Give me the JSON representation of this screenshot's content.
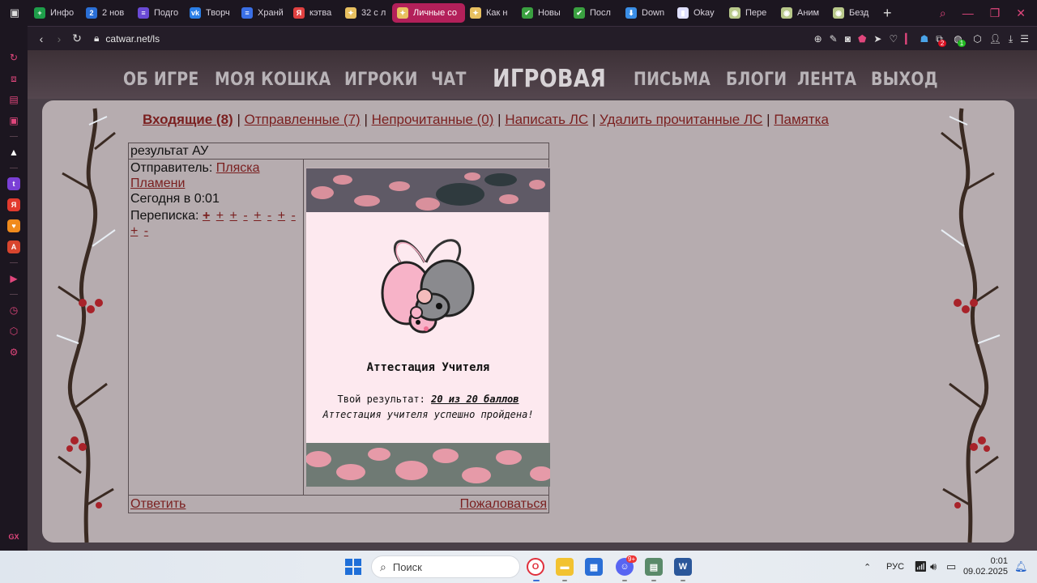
{
  "tabs": [
    {
      "label": "Инфо",
      "color": "#1e9e4a",
      "glyph": "+"
    },
    {
      "label": "2 нов",
      "color": "#2a6fd6",
      "glyph": "2"
    },
    {
      "label": "Подго",
      "color": "#6a4ad6",
      "glyph": "≡"
    },
    {
      "label": "Творч",
      "color": "#2a7ee6",
      "glyph": "vk"
    },
    {
      "label": "Хранй",
      "color": "#3a6fe6",
      "glyph": "≡"
    },
    {
      "label": "кэтва",
      "color": "#e04040",
      "glyph": "Я"
    },
    {
      "label": "32 с л",
      "color": "#e8c060",
      "glyph": "✦"
    },
    {
      "label": "Личные со",
      "color": "#e8c060",
      "glyph": "✦",
      "active": true
    },
    {
      "label": "Как н",
      "color": "#e8c060",
      "glyph": "✦"
    },
    {
      "label": "Новы",
      "color": "#3aa040",
      "glyph": "✔"
    },
    {
      "label": "Посл",
      "color": "#3aa040",
      "glyph": "✔"
    },
    {
      "label": "Down",
      "color": "#3a8ee6",
      "glyph": "⬇"
    },
    {
      "label": "Okay",
      "color": "#e0e0ff",
      "glyph": "▮"
    },
    {
      "label": "Пере",
      "color": "#b8c88a",
      "glyph": "◉"
    },
    {
      "label": "Аним",
      "color": "#b8c88a",
      "glyph": "◉"
    },
    {
      "label": "Безд",
      "color": "#b8c88a",
      "glyph": "◉"
    }
  ],
  "address": {
    "url": "catwar.net/ls"
  },
  "addr_badges": {
    "red": "2",
    "green": "1"
  },
  "menu": {
    "about": "ОБ ИГРЕ",
    "mycat": "МОЯ КОШКА",
    "players": "ИГРОКИ",
    "chat": "ЧАТ",
    "game": "ИГРОВАЯ",
    "letters": "ПИСЬМА",
    "blogs": "БЛОГИ",
    "feed": "ЛЕНТА",
    "exit": "ВЫХОД"
  },
  "mail_links": {
    "inbox": "Входящие (8)",
    "sent": "Отправленные (7)",
    "unread": "Непрочитанные (0)",
    "write": "Написать ЛС",
    "delete_read": "Удалить прочитанные ЛС",
    "memo": "Памятка",
    "sep": "|"
  },
  "message": {
    "subject": "результат АУ",
    "sender_label": "Отправитель:",
    "sender_name": "Пляска Пламени",
    "date": "Сегодня в 0:01",
    "correspondence_label": "Переписка:",
    "correspondence": [
      "+",
      "+",
      "+",
      "-",
      "+",
      "-",
      "+",
      "-",
      "+",
      "-"
    ],
    "body_title": "Аттестация Учителя",
    "result_label": "Твой результат:",
    "result_value": "20 из 20 баллов",
    "result_note": "Аттестация учителя успешно пройдена!",
    "reply": "Ответить",
    "complain": "Пожаловаться"
  },
  "taskbar": {
    "search_placeholder": "Поиск",
    "lang": "РУС",
    "time": "0:01",
    "date": "09.02.2025",
    "discord_badge": "9+"
  }
}
